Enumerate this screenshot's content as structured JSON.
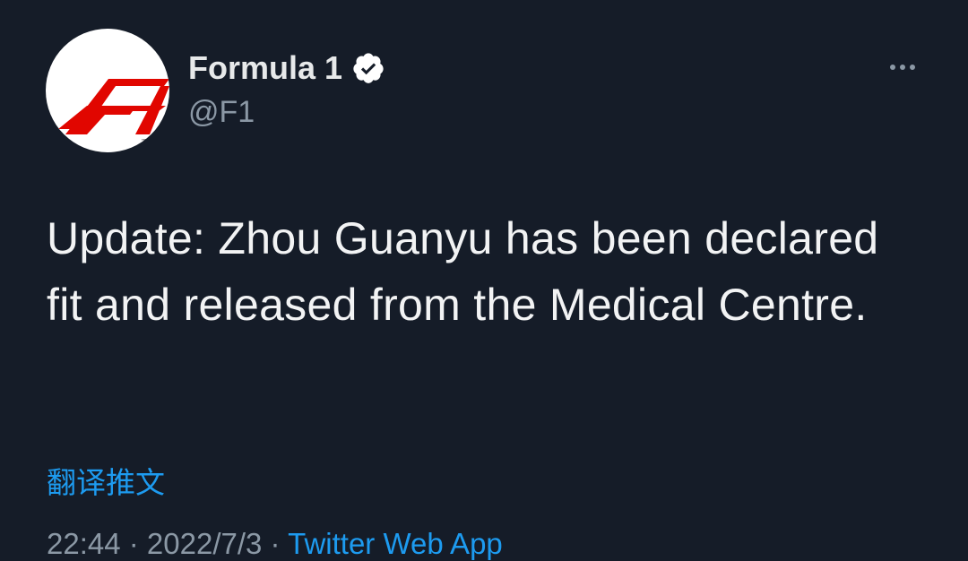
{
  "account": {
    "display_name": "Formula 1",
    "handle": "@F1",
    "avatar_icon": "f1-logo-icon",
    "verified_icon": "verified-badge-icon",
    "brand_color": "#e10600"
  },
  "tweet": {
    "text": "Update: Zhou Guanyu has been declared fit and released from the Medical Centre.",
    "translate_label": "翻译推文",
    "timestamp": "22:44 · 2022/7/3",
    "separator": " · ",
    "source": "Twitter Web App"
  },
  "actions": {
    "more_icon": "more-options-icon"
  },
  "colors": {
    "background": "#151c28",
    "link": "#1d9bf0",
    "secondary_text": "#8b98a5"
  }
}
